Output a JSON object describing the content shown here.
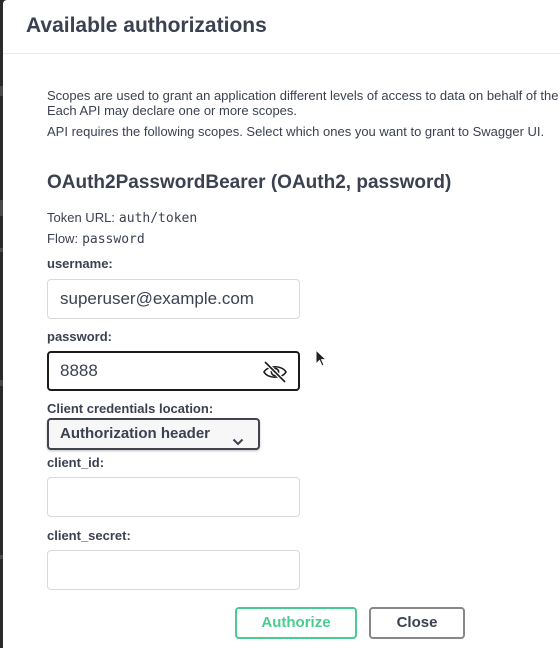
{
  "modal": {
    "title": "Available authorizations"
  },
  "scopes": {
    "description_line1": "Scopes are used to grant an application different levels of access to data on behalf of the",
    "description_line2": "Each API may declare one or more scopes.",
    "required_text": "API requires the following scopes. Select which ones you want to grant to Swagger UI."
  },
  "scheme": {
    "title": "OAuth2PasswordBearer (OAuth2, password)",
    "token_url_label": "Token URL:",
    "token_url_value": "auth/token",
    "flow_label": "Flow:",
    "flow_value": "password"
  },
  "form": {
    "username_label": "username:",
    "username_value": "superuser@example.com",
    "password_label": "password:",
    "password_value": "8888",
    "password_toggle_icon": "eye-slash-icon",
    "client_credentials_label": "Client credentials location:",
    "client_credentials_selected": "Authorization header",
    "client_id_label": "client_id:",
    "client_id_value": "",
    "client_secret_label": "client_secret:",
    "client_secret_value": ""
  },
  "buttons": {
    "authorize_label": "Authorize",
    "close_label": "Close"
  },
  "colors": {
    "authorize_accent": "#49cc90",
    "text": "#3b4151",
    "focus_border": "#1b1b1b"
  }
}
